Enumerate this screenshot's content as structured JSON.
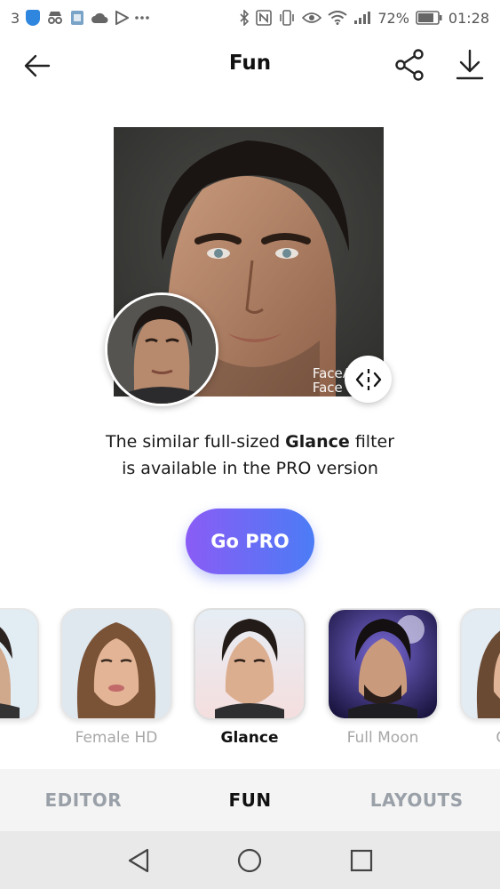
{
  "status_bar": {
    "notification_count": "3",
    "battery_percent": "72%",
    "time": "01:28",
    "icons_left": [
      "shield-icon",
      "incognito-icon",
      "image-icon",
      "cloud-icon",
      "play-icon",
      "more-notifications-icon"
    ],
    "icons_right": [
      "bluetooth-icon",
      "nfc-icon",
      "vibrate-icon",
      "eye-icon",
      "wifi-icon",
      "signal-icon",
      "battery-icon"
    ]
  },
  "app_bar": {
    "title": "Fun",
    "back_icon": "arrow-left-icon",
    "share_icon": "share-icon",
    "download_icon": "download-icon"
  },
  "preview": {
    "watermark_line1": "FaceA",
    "watermark_line2": "Face",
    "compare_icon": "compare-split-icon"
  },
  "promo": {
    "text_before": "The similar full-sized ",
    "filter_name": "Glance",
    "text_after": " filter",
    "line2": "is available in the PRO version",
    "button_label": "Go PRO"
  },
  "filters": [
    {
      "label": "",
      "selected": false
    },
    {
      "label": "Female HD",
      "selected": false
    },
    {
      "label": "Glance",
      "selected": true
    },
    {
      "label": "Full Moon",
      "selected": false
    },
    {
      "label": "Gend",
      "selected": false
    }
  ],
  "tabs": [
    {
      "label": "EDITOR",
      "active": false
    },
    {
      "label": "FUN",
      "active": true
    },
    {
      "label": "LAYOUTS",
      "active": false
    }
  ],
  "system_nav": [
    "back-triangle-icon",
    "home-circle-icon",
    "recents-square-icon"
  ],
  "colors": {
    "go_pro_gradient_start": "#8a5cf6",
    "go_pro_gradient_end": "#4b7cf6",
    "tab_inactive": "#9aa0a8",
    "tab_active": "#111111"
  }
}
